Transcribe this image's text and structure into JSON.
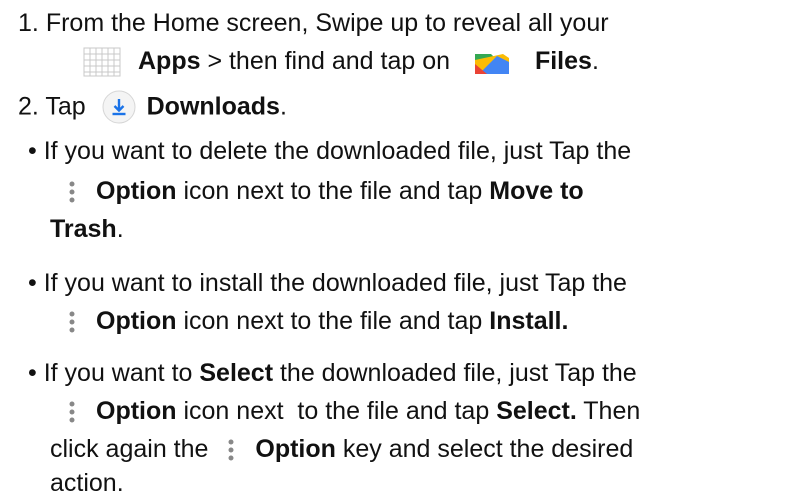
{
  "step1": {
    "number": "1.",
    "text": "From the Home screen, Swipe up to reveal all your",
    "apps_label": "Apps",
    "middle": " > then find and tap on ",
    "files_label": "Files",
    "end": "."
  },
  "step2": {
    "number": "2.",
    "prefix": "Tap",
    "downloads_label": "Downloads",
    "end": "."
  },
  "bullet1": {
    "marker": "•",
    "text_a": "If you want to delete the downloaded file, just Tap the",
    "option_label": "Option",
    "text_b": " icon next to the file and tap ",
    "action_a": "Move to",
    "action_b": "Trash",
    "end": "."
  },
  "bullet2": {
    "marker": "•",
    "text_a": "If you want to install the downloaded file, just Tap the",
    "option_label": "Option",
    "text_b": " icon next to the file and tap ",
    "action": "Install."
  },
  "bullet3": {
    "marker": "•",
    "text_a1": "If you want to ",
    "select_word": "Select",
    "text_a2": " the downloaded file, just Tap the",
    "option_label": "Option",
    "text_b": " icon next  to the file and tap ",
    "select_action": "Select.",
    "text_b2": " Then",
    "text_c1": "click again the ",
    "option_label_2": "Option",
    "text_c2": " key and select the desired",
    "text_d": "action."
  },
  "icons": {
    "apps": "apps-grid-icon",
    "files": "files-app-icon",
    "downloads": "download-icon",
    "option": "more-vertical-icon",
    "download_color": "#1a73e8"
  }
}
